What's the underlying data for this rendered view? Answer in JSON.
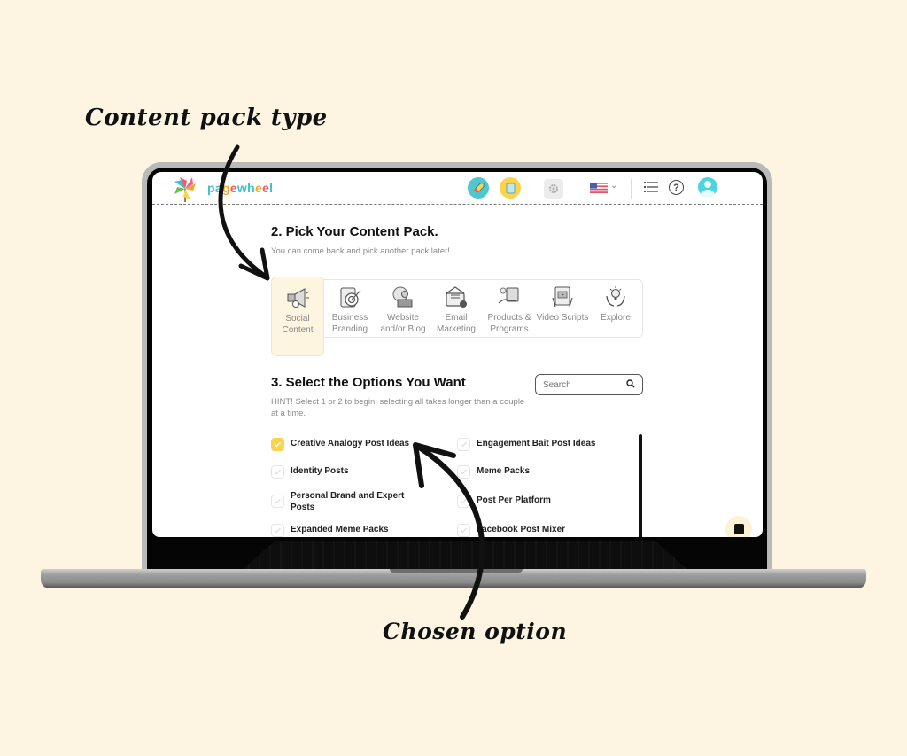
{
  "annotations": {
    "top_label": "Content pack type",
    "bottom_label": "Chosen option"
  },
  "header": {
    "brand_letters": [
      "p",
      "a",
      "g",
      "e",
      "w",
      "h",
      "e",
      "e",
      "l"
    ],
    "brand_colors": [
      "#3fbfcf",
      "#3fbfcf",
      "#f5a623",
      "#ef5b6a",
      "#3fbfcf",
      "#3fbfcf",
      "#f5a623",
      "#ef5b6a",
      "#3fbfcf"
    ],
    "icons": [
      "rocket-icon",
      "document-icon",
      "gear-icon",
      "us-flag-icon",
      "chevron-down-icon",
      "list-icon",
      "help-icon",
      "avatar"
    ],
    "help_glyph": "?",
    "chevron_glyph": "⌄"
  },
  "section2": {
    "title": "2. Pick Your Content Pack.",
    "subtitle": "You can come back and pick another pack later!",
    "packs": [
      {
        "label": "Social Content",
        "icon": "megaphone-icon",
        "active": true
      },
      {
        "label": "Business Branding",
        "icon": "target-clipboard-icon",
        "active": false
      },
      {
        "label": "Website and/or Blog",
        "icon": "web-developer-icon",
        "active": false
      },
      {
        "label": "Email Marketing",
        "icon": "envelope-icon",
        "active": false
      },
      {
        "label": "Products & Programs",
        "icon": "product-hand-icon",
        "active": false
      },
      {
        "label": "Video Scripts",
        "icon": "video-script-icon",
        "active": false
      },
      {
        "label": "Explore",
        "icon": "lightbulb-hands-icon",
        "active": false
      }
    ]
  },
  "section3": {
    "title": "3. Select the Options You Want",
    "hint": "HINT! Select 1 or 2 to begin, selecting all takes longer than a couple at a time.",
    "search_placeholder": "Search",
    "options": [
      {
        "label": "Creative Analogy Post Ideas",
        "checked": true
      },
      {
        "label": "Engagement Bait Post Ideas",
        "checked": false
      },
      {
        "label": "Identity Posts",
        "checked": false
      },
      {
        "label": "Meme Packs",
        "checked": false
      },
      {
        "label": "Personal Brand and Expert Posts",
        "checked": false
      },
      {
        "label": "Post Per Platform",
        "checked": false
      },
      {
        "label": "Expanded Meme Packs",
        "checked": false
      },
      {
        "label": "Facebook Post Mixer",
        "checked": false
      }
    ]
  },
  "colors": {
    "background": "#fdf5e2",
    "accent_yellow": "#fcd34d",
    "accent_teal": "#4fc6d0"
  }
}
